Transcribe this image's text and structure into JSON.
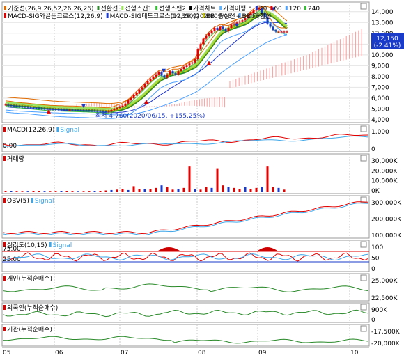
{
  "colors": {
    "background": "#ffffff",
    "frame": "#9a9a9a",
    "grid": "#c9c9c9",
    "up": "#e00000",
    "down": "#1a3ac8",
    "kijun": "#e06a00",
    "tenkan": "#2a8a2a",
    "span1": "#9be25a",
    "span2": "#30c030",
    "ma5": "#5cb4ff",
    "ma20": "#1a33c8",
    "ma60": "#e00000",
    "ma120": "#4aa0ff",
    "ma240": "#30c030",
    "cloud": "#ff9999",
    "bb_upper": "#e06a00",
    "bb_mid": "#c8c800",
    "macd": "#e00000",
    "signal": "#3fa7e8",
    "price_tag_bg": "#1a3ac8",
    "psych_fill": "#cc0000",
    "green": "#2a8a2a"
  },
  "legend_main": [
    {
      "label": "기준선(26,9,26,52,26,26,26)",
      "color": "#e06a00"
    },
    {
      "label": "전환선",
      "color": "#2a8a2a"
    },
    {
      "label": "선행스팬1",
      "color": "#9be25a"
    },
    {
      "label": "선행스팬2",
      "color": "#30c030"
    },
    {
      "label": "가격차트",
      "color": "#000000"
    },
    {
      "label": "가격이평 5",
      "color": "#5cb4ff"
    },
    {
      "label": "20",
      "color": "#1a33c8"
    },
    {
      "label": "60",
      "color": "#e00000"
    },
    {
      "label": "120",
      "color": "#4aa0ff"
    },
    {
      "label": "240",
      "color": "#30c030"
    }
  ],
  "legend_main2": [
    {
      "label": "MACD-SIG와골든크로스(12,26,9)",
      "color": "#e00000"
    },
    {
      "label": "MACD-SIG데드크로스(12,26,9)",
      "color": "#1a3ac8"
    },
    {
      "label": "BB_중심선",
      "color": "#c8c800"
    },
    {
      "label": "BB_하한선",
      "color": "#4aa0ff"
    }
  ],
  "overlay_info": "14,350(2020/09/08, +34.13%)",
  "low_note": "최저 4,760(2020/06/15, +155.25%)",
  "price_tag": {
    "value": "12,150",
    "change": "(-2.41%)"
  },
  "x_labels": [
    "05",
    "06",
    "07",
    "08",
    "09",
    "10"
  ],
  "panels": {
    "macd": {
      "title": "MACD(12,26,9)",
      "signal": "Signal",
      "left_value": "0.00",
      "ticks": [
        "1,000",
        "0"
      ]
    },
    "volume": {
      "title": "거래량",
      "ticks": [
        "30,000K",
        "20,000K",
        "10,000K",
        "0K"
      ]
    },
    "obv": {
      "title": "OBV(5)",
      "signal": "Signal",
      "ticks": [
        "300,000K",
        "200,000K",
        "100,000K"
      ]
    },
    "psych": {
      "title": "심리도(10,15)",
      "signal": "Signal",
      "ticks": [
        "100",
        "50",
        "0"
      ],
      "left_upper": "75.00",
      "left_lower": "25.00"
    },
    "individual": {
      "title": "개인(누적순매수)",
      "ticks": [
        "25,000K",
        "22,500K"
      ]
    },
    "foreign": {
      "title": "외국인(누적순매수)",
      "ticks": [
        "900K",
        "0"
      ]
    },
    "institution": {
      "title": "기관(누적순매수)",
      "ticks": [
        "-17,500K",
        "-20,000K"
      ]
    }
  },
  "chart_data": [
    {
      "type": "line",
      "title": "가격차트",
      "y_ticks": [
        "14,000",
        "13,000",
        "12,000",
        "11,000",
        "10,000",
        "9,000",
        "8,000",
        "7,000",
        "6,000",
        "5,000",
        "4,000"
      ],
      "ylim": [
        4000,
        14500
      ],
      "x": [
        0,
        4,
        8,
        12,
        16,
        20,
        24,
        28,
        32,
        36,
        40,
        44,
        48,
        52,
        56,
        60,
        64,
        68,
        72,
        76,
        80,
        84,
        88,
        92,
        96,
        100,
        104,
        108,
        112,
        116,
        120,
        124,
        128,
        132,
        136,
        140,
        144,
        148,
        152,
        156,
        160,
        164,
        168,
        172,
        176,
        180,
        184,
        188,
        192,
        196,
        200,
        204,
        208,
        212,
        216,
        220,
        224,
        228,
        232,
        236,
        240,
        244,
        248,
        252,
        256,
        260,
        264,
        268,
        272,
        276,
        280,
        284,
        288,
        292,
        296,
        300,
        304,
        308,
        312,
        316,
        320,
        324,
        328,
        332,
        336,
        340,
        344,
        348,
        352,
        356,
        360,
        364,
        368,
        372,
        376,
        380,
        384,
        388,
        392,
        396,
        400,
        404
      ],
      "series": [
        {
          "name": "가격차트",
          "values": [
            5400,
            5350,
            5300,
            5280,
            5250,
            5220,
            5200,
            5180,
            5150,
            5120,
            5100,
            5080,
            5050,
            5030,
            5000,
            4990,
            4980,
            4970,
            4960,
            4950,
            4940,
            4930,
            4920,
            4920,
            4910,
            4900,
            4890,
            4880,
            4870,
            4860,
            4850,
            4840,
            4820,
            4800,
            4780,
            4770,
            4760,
            4800,
            4900,
            5000,
            5100,
            5200,
            5300,
            5500,
            5800,
            6000,
            6300,
            6500,
            6800,
            7000,
            7300,
            7600,
            7800,
            8000,
            8200,
            8400,
            8100,
            7900,
            8200,
            8500,
            8300,
            8200,
            8500,
            8700,
            8900,
            9000,
            9200,
            9300,
            9600,
            10500,
            11000,
            11500,
            11800,
            12000,
            12200,
            12500,
            12300,
            12600,
            12400,
            12200,
            12500,
            12800,
            12900,
            13000,
            13100,
            13200,
            13400,
            13700,
            13900,
            14100,
            14200,
            14350,
            13900,
            13500,
            12900,
            12600,
            12300,
            12150,
            12150,
            12150,
            12150,
            12150
          ]
        }
      ]
    },
    {
      "type": "bar",
      "title": "거래량",
      "x": [
        0,
        8,
        16,
        24,
        32,
        40,
        48,
        56,
        64,
        72,
        80,
        88,
        96,
        104,
        112,
        120,
        128,
        136,
        144,
        152,
        160,
        168,
        176,
        184,
        192,
        200,
        208,
        216,
        224,
        232,
        240,
        248,
        256,
        264,
        272,
        280,
        288,
        296,
        304,
        312,
        320,
        328,
        336,
        344,
        352,
        360,
        368,
        376,
        384,
        392,
        400
      ],
      "values": [
        800,
        900,
        700,
        600,
        700,
        900,
        800,
        700,
        600,
        700,
        900,
        800,
        700,
        600,
        600,
        700,
        800,
        1500,
        2000,
        2500,
        3000,
        3500,
        2500,
        7000,
        4000,
        3500,
        4000,
        5000,
        8000,
        6000,
        3000,
        4000,
        5000,
        30000,
        4000,
        3000,
        6000,
        5000,
        28000,
        8000,
        6000,
        5000,
        4000,
        6000,
        4000,
        5000,
        6000,
        30000,
        6000,
        5000,
        3000
      ],
      "ylim": [
        0,
        35000
      ]
    }
  ]
}
